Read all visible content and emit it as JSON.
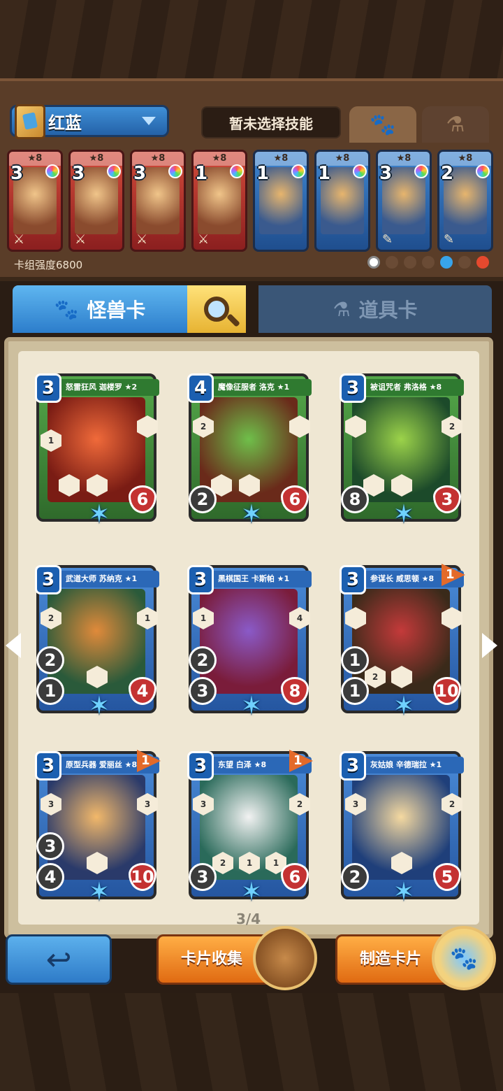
{
  "deck": {
    "name": "红蓝",
    "skill_placeholder": "暂未选择技能",
    "strength_label": "卡组强度6800",
    "tabs": [
      "paw",
      "potion"
    ]
  },
  "deck_cards": [
    {
      "cost": "3",
      "stars": "★8",
      "color": "red",
      "gem": true
    },
    {
      "cost": "3",
      "stars": "★8",
      "color": "red",
      "gem": true
    },
    {
      "cost": "3",
      "stars": "★8",
      "color": "red",
      "gem": true
    },
    {
      "cost": "1",
      "stars": "★8",
      "color": "red",
      "gem": true
    },
    {
      "cost": "1",
      "stars": "★8",
      "color": "blue",
      "gem": true
    },
    {
      "cost": "1",
      "stars": "★8",
      "color": "blue",
      "gem": true
    },
    {
      "cost": "3",
      "stars": "★8",
      "color": "blue",
      "gem": true
    },
    {
      "cost": "2",
      "stars": "★8",
      "color": "blue",
      "gem": true
    }
  ],
  "collection_tabs": {
    "monster": "怪兽卡",
    "item": "道具卡"
  },
  "cards": [
    {
      "name": "怒雷狂风 迦楼罗 ★2",
      "cost": "3",
      "atk": "",
      "atk2": "",
      "hp": "6",
      "flag": "",
      "color": "green",
      "hexes": [
        "1",
        "",
        "",
        ""
      ]
    },
    {
      "name": "魔像征服者 洛克 ★1",
      "cost": "4",
      "atk": "2",
      "atk2": "",
      "hp": "6",
      "flag": "",
      "color": "green",
      "hexes": [
        "2",
        "",
        "",
        ""
      ]
    },
    {
      "name": "被诅咒者 弗洛格 ★8",
      "cost": "3",
      "atk": "8",
      "atk2": "",
      "hp": "3",
      "flag": "",
      "color": "green",
      "hexes": [
        "",
        "2",
        "",
        ""
      ]
    },
    {
      "name": "武道大师 苏纳克 ★1",
      "cost": "3",
      "atk": "1",
      "atk2": "2",
      "hp": "4",
      "flag": "",
      "color": "blue",
      "hexes": [
        "2",
        "1",
        "",
        ""
      ]
    },
    {
      "name": "黑棋国王 卡斯帕 ★1",
      "cost": "3",
      "atk": "3",
      "atk2": "2",
      "hp": "8",
      "flag": "",
      "color": "blue",
      "hexes": [
        "1",
        "4",
        "",
        ""
      ]
    },
    {
      "name": "参谋长 威思顿 ★8",
      "cost": "3",
      "atk": "1",
      "atk2": "1",
      "hp": "10",
      "flag": "1",
      "color": "blue",
      "hexes": [
        "",
        "",
        "2",
        ""
      ]
    },
    {
      "name": "原型兵器 爱丽丝 ★8",
      "cost": "3",
      "atk": "4",
      "atk2": "3",
      "hp": "10",
      "flag": "1",
      "color": "blue",
      "hexes": [
        "3",
        "3",
        "",
        ""
      ]
    },
    {
      "name": "东望 白泽 ★8",
      "cost": "3",
      "atk": "3",
      "atk2": "",
      "hp": "6",
      "flag": "1",
      "color": "blue",
      "hexes": [
        "3",
        "2",
        "2",
        "1"
      ]
    },
    {
      "name": "灰姑娘 辛德瑞拉 ★1",
      "cost": "3",
      "atk": "2",
      "atk2": "",
      "hp": "5",
      "flag": "",
      "color": "blue",
      "hexes": [
        "3",
        "2",
        "",
        ""
      ]
    }
  ],
  "pagination": "3/4",
  "buttons": {
    "collect": "卡片收集",
    "craft": "制造卡片"
  },
  "colors": {
    "red_card": "#c43a2f",
    "blue_card": "#2e6fbf",
    "accent_orange": "#e58524"
  }
}
